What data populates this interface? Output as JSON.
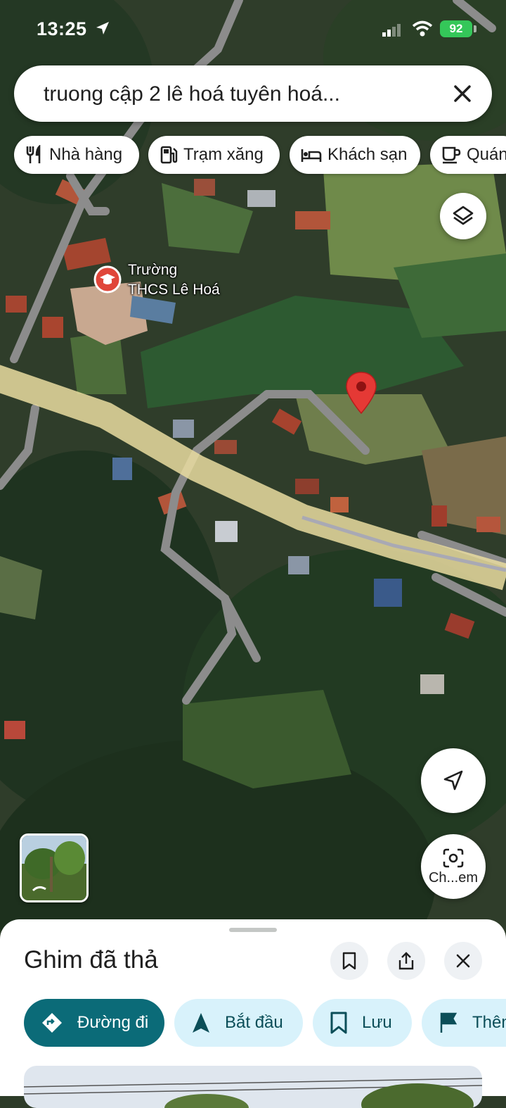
{
  "status_bar": {
    "time": "13:25",
    "battery": "92"
  },
  "search": {
    "query": "truong cập 2 lê hoá tuyên hoá..."
  },
  "chips": [
    {
      "label": "Nhà hàng",
      "icon": "fork-knife-icon"
    },
    {
      "label": "Trạm xăng",
      "icon": "gas-station-icon"
    },
    {
      "label": "Khách sạn",
      "icon": "bed-icon"
    },
    {
      "label": "Quán",
      "icon": "coffee-icon"
    }
  ],
  "map": {
    "poi_label_line1": "Trường",
    "poi_label_line2": "THCS Lê Hoá",
    "poi_icon": "school-icon",
    "pin_icon": "map-pin-icon"
  },
  "controls": {
    "lens_label": "Ch...em"
  },
  "sheet": {
    "title": "Ghim đã thả",
    "actions": [
      {
        "label": "Đường đi",
        "icon": "directions-icon"
      },
      {
        "label": "Bắt đầu",
        "icon": "navigation-arrow-icon"
      },
      {
        "label": "Lưu",
        "icon": "bookmark-icon"
      },
      {
        "label": "Thêm",
        "icon": "flag-icon"
      }
    ]
  },
  "colors": {
    "primary_action": "#0b6b78",
    "secondary_action": "#d8f2fb",
    "pin": "#e53935",
    "highlight_road": "#e9dca0"
  }
}
